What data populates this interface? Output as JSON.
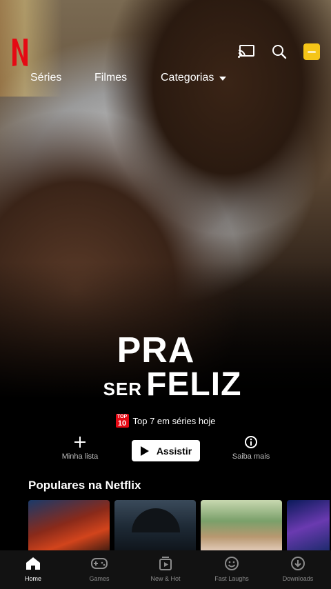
{
  "header": {
    "logo_alt": "N",
    "icons": [
      "cast-icon",
      "search-icon",
      "profile-avatar"
    ]
  },
  "nav": {
    "series": "Séries",
    "movies": "Filmes",
    "categories": "Categorias"
  },
  "hero": {
    "title_line1": "PRA",
    "title_line2_small": "SER",
    "title_line2_big": "FELIZ",
    "top10_badge_top": "TOP",
    "top10_badge_num": "10",
    "ranking_text": "Top 7 em séries hoje"
  },
  "actions": {
    "my_list": "Minha lista",
    "play": "Assistir",
    "more_info": "Saiba mais"
  },
  "row": {
    "title": "Populares na Netflix"
  },
  "bottom_nav": {
    "items": [
      {
        "label": "Home",
        "icon": "home-icon",
        "active": true
      },
      {
        "label": "Games",
        "icon": "gamepad-icon",
        "active": false
      },
      {
        "label": "New & Hot",
        "icon": "play-stack-icon",
        "active": false
      },
      {
        "label": "Fast Laughs",
        "icon": "smile-icon",
        "active": false
      },
      {
        "label": "Downloads",
        "icon": "download-icon",
        "active": false
      }
    ]
  },
  "colors": {
    "brand": "#e50914",
    "avatar": "#f5c518"
  }
}
